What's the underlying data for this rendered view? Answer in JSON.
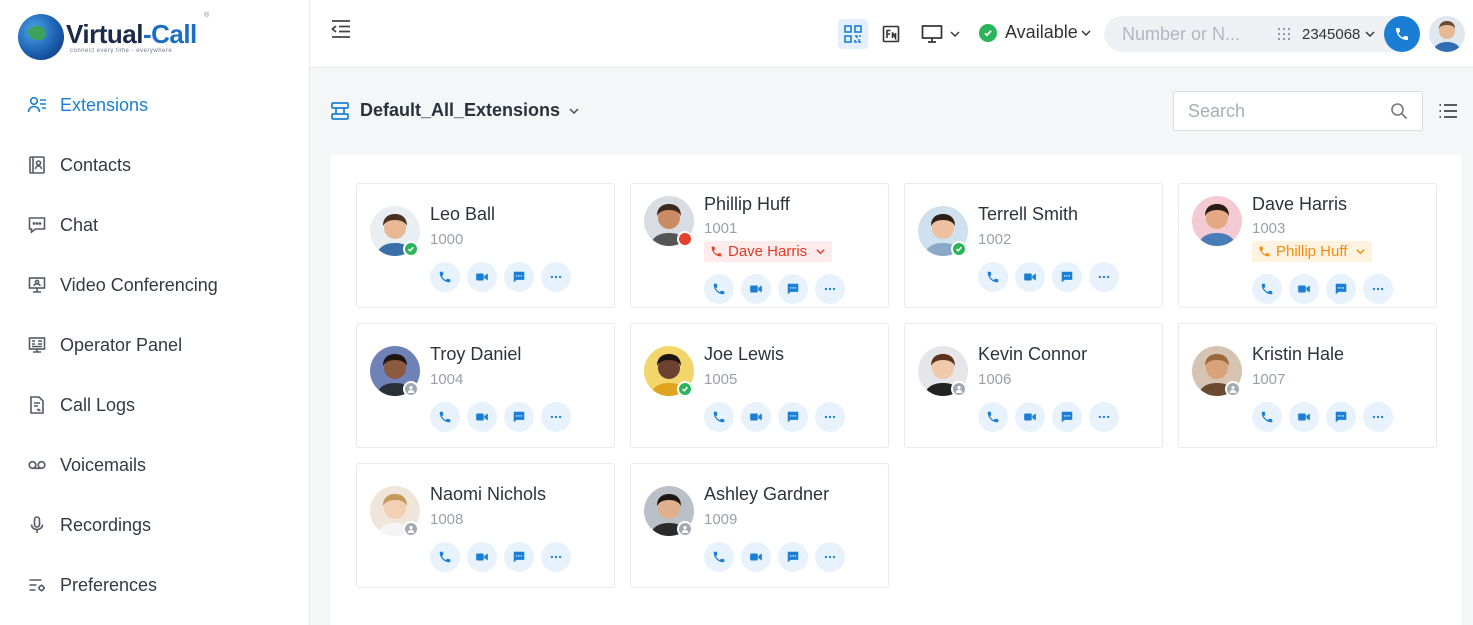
{
  "app": {
    "logo_main": "Virtual",
    "logo_main2": "-Call",
    "logo_tagline": "connect every time - everywhere",
    "logo_reg": "®"
  },
  "sidebar": {
    "items": [
      {
        "label": "Extensions",
        "icon": "users-icon",
        "active": true
      },
      {
        "label": "Contacts",
        "icon": "contacts-icon",
        "active": false
      },
      {
        "label": "Chat",
        "icon": "chat-icon",
        "active": false
      },
      {
        "label": "Video Conferencing",
        "icon": "video-conference-icon",
        "active": false
      },
      {
        "label": "Operator Panel",
        "icon": "operator-panel-icon",
        "active": false
      },
      {
        "label": "Call Logs",
        "icon": "call-logs-icon",
        "active": false
      },
      {
        "label": "Voicemails",
        "icon": "voicemail-icon",
        "active": false
      },
      {
        "label": "Recordings",
        "icon": "microphone-icon",
        "active": false
      },
      {
        "label": "Preferences",
        "icon": "preferences-icon",
        "active": false
      }
    ]
  },
  "topbar": {
    "status_label": "Available",
    "dial_placeholder": "Number or N...",
    "extension_number": "2345068"
  },
  "content": {
    "group_title": "Default_All_Extensions",
    "search_placeholder": "Search"
  },
  "colors": {
    "accent": "#1a7fd4",
    "available": "#2bb55a",
    "busy": "#e5402b",
    "offline": "#a3a9b2",
    "ringing": "#f08c12"
  },
  "extensions": [
    {
      "name": "Leo Ball",
      "ext": "1000",
      "status": "available",
      "talking_with": ""
    },
    {
      "name": "Phillip Huff",
      "ext": "1001",
      "status": "busy",
      "talking_with": "Dave Harris"
    },
    {
      "name": "Terrell Smith",
      "ext": "1002",
      "status": "available",
      "talking_with": ""
    },
    {
      "name": "Dave Harris",
      "ext": "1003",
      "status": "none",
      "talking_with": "Phillip Huff"
    },
    {
      "name": "Troy Daniel",
      "ext": "1004",
      "status": "offline",
      "talking_with": ""
    },
    {
      "name": "Joe Lewis",
      "ext": "1005",
      "status": "available",
      "talking_with": ""
    },
    {
      "name": "Kevin Connor",
      "ext": "1006",
      "status": "offline",
      "talking_with": ""
    },
    {
      "name": "Kristin Hale",
      "ext": "1007",
      "status": "offline",
      "talking_with": ""
    },
    {
      "name": "Naomi Nichols",
      "ext": "1008",
      "status": "offline",
      "talking_with": ""
    },
    {
      "name": "Ashley Gardner",
      "ext": "1009",
      "status": "offline",
      "talking_with": ""
    }
  ]
}
